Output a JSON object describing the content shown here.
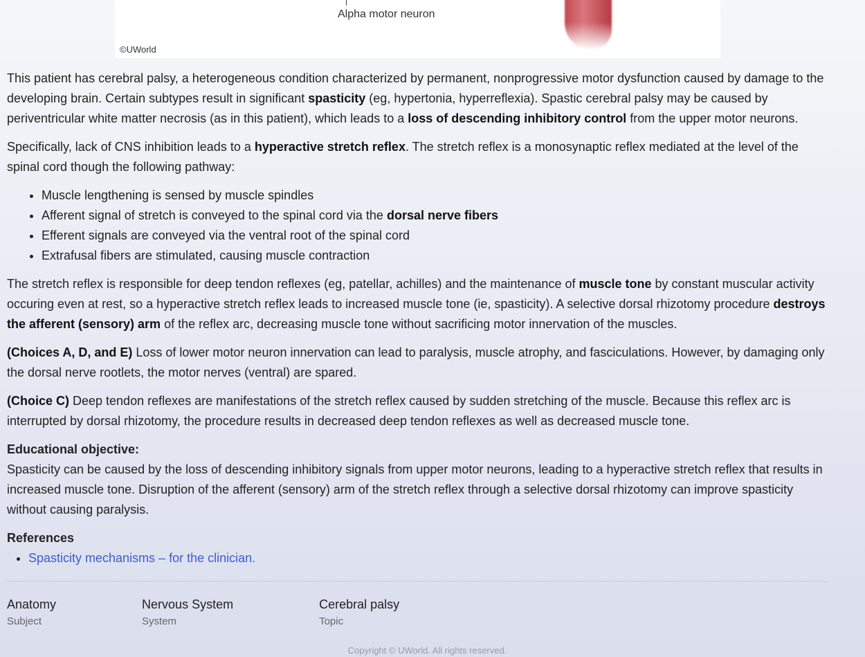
{
  "figure": {
    "label": "Alpha motor neuron",
    "copyright": "©UWorld"
  },
  "paragraphs": [
    [
      [
        "This patient has cerebral palsy, a heterogeneous condition characterized by permanent, nonprogressive motor dysfunction caused by damage to the developing brain.  Certain subtypes result in significant ",
        0
      ],
      [
        "spasticity",
        1
      ],
      [
        " (eg, hypertonia, hyperreflexia).  Spastic cerebral palsy may be caused by periventricular white matter necrosis (as in this patient), which leads to a ",
        0
      ],
      [
        "loss of descending inhibitory control",
        1
      ],
      [
        " from the upper motor neurons.",
        0
      ]
    ],
    [
      [
        "Specifically, lack of CNS inhibition leads to a ",
        0
      ],
      [
        "hyperactive stretch reflex",
        1
      ],
      [
        ".  The stretch reflex is a monosynaptic reflex mediated at the level of the spinal cord though the following pathway:",
        0
      ]
    ]
  ],
  "bullets": [
    [
      [
        "Muscle lengthening is sensed by muscle spindles",
        0
      ]
    ],
    [
      [
        "Afferent signal of stretch is conveyed to the spinal cord via the ",
        0
      ],
      [
        "dorsal nerve fibers",
        1
      ]
    ],
    [
      [
        "Efferent signals are conveyed via the ventral root of the spinal cord",
        0
      ]
    ],
    [
      [
        "Extrafusal fibers are stimulated, causing muscle contraction",
        0
      ]
    ]
  ],
  "paragraphs2": [
    [
      [
        "The stretch reflex is responsible for deep tendon reflexes (eg, patellar, achilles) and the maintenance of ",
        0
      ],
      [
        "muscle tone",
        1
      ],
      [
        " by constant muscular activity occuring even at rest, so a hyperactive stretch reflex leads to increased muscle tone (ie, spasticity).  A selective dorsal rhizotomy procedure ",
        0
      ],
      [
        "destroys the afferent (sensory) arm",
        1
      ],
      [
        " of the reflex arc, decreasing muscle tone without sacrificing motor innervation of the muscles.",
        0
      ]
    ],
    [
      [
        "(Choices A, D, and E)",
        1
      ],
      [
        "  Loss of lower motor neuron innervation can lead to paralysis, muscle atrophy, and fasciculations.  However, by damaging only the dorsal nerve rootlets, the motor nerves (ventral) are spared.",
        0
      ]
    ],
    [
      [
        "(Choice C)",
        1
      ],
      [
        "  Deep tendon reflexes are manifestations of the stretch reflex caused by sudden stretching of the muscle.  Because this reflex arc is interrupted by dorsal rhizotomy, the procedure results in decreased deep tendon reflexes as well as decreased muscle tone.",
        0
      ]
    ]
  ],
  "objective": {
    "heading": "Educational objective:",
    "text": "Spasticity can be caused by the loss of descending inhibitory signals from upper motor neurons, leading to a hyperactive stretch reflex that results in increased muscle tone.  Disruption of the afferent (sensory) arm of the stretch reflex through a selective dorsal rhizotomy can improve spasticity without causing paralysis."
  },
  "references": {
    "heading": "References",
    "items": [
      "Spasticity mechanisms – for the clinician."
    ]
  },
  "meta": [
    {
      "value": "Anatomy",
      "label": "Subject"
    },
    {
      "value": "Nervous System",
      "label": "System"
    },
    {
      "value": "Cerebral palsy",
      "label": "Topic"
    }
  ],
  "copyright": "Copyright © UWorld. All rights reserved."
}
